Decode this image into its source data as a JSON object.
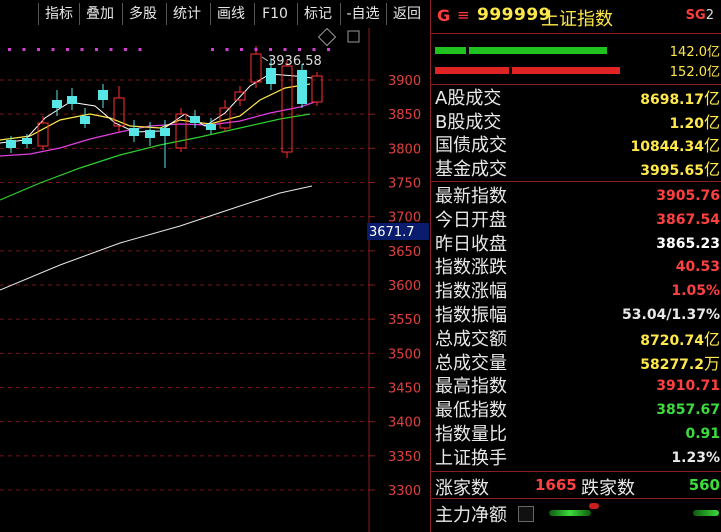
{
  "toolbar": {
    "buttons": [
      "指标",
      "叠加",
      "多股",
      "统计",
      "画线",
      "F10",
      "标记",
      "-自选",
      "返回"
    ]
  },
  "chart": {
    "price_labels": [
      "3900",
      "3850",
      "3800",
      "3750",
      "3700",
      "3650",
      "3600",
      "3550",
      "3500",
      "3450",
      "3400",
      "3350",
      "3300"
    ],
    "high_label": "3936.58",
    "crosshair_label": "3671.7"
  },
  "header": {
    "g_label": "G",
    "menu_icon": "menu-icon",
    "code": "999999",
    "name": "上证指数",
    "sg": "SG",
    "sg_num": "2",
    "buy_value": "142.0亿",
    "sell_value": "152.0亿"
  },
  "turnover": [
    {
      "label": "A股成交",
      "value": "8698.17",
      "unit": "亿"
    },
    {
      "label": "B股成交",
      "value": "1.20",
      "unit": "亿"
    },
    {
      "label": "国债成交",
      "value": "10844.34",
      "unit": "亿"
    },
    {
      "label": "基金成交",
      "value": "3995.65",
      "unit": "亿"
    }
  ],
  "stats": [
    {
      "label": "最新指数",
      "value": "3905.76",
      "color": "#ff4040"
    },
    {
      "label": "今日开盘",
      "value": "3867.54",
      "color": "#ff4040"
    },
    {
      "label": "昨日收盘",
      "value": "3865.23",
      "color": "#ffffff"
    },
    {
      "label": "指数涨跌",
      "value": "40.53",
      "color": "#ff4040"
    },
    {
      "label": "指数涨幅",
      "value": "1.05%",
      "color": "#ff4040"
    },
    {
      "label": "指数振幅",
      "value": "53.04/1.37%",
      "color": "#e8e8e8"
    },
    {
      "label": "总成交额",
      "value": "8720.74",
      "unit": "亿",
      "color": "#ffe84a"
    },
    {
      "label": "总成交量",
      "value": "58277.2",
      "unit": "万",
      "color": "#ffe84a"
    },
    {
      "label": "最高指数",
      "value": "3910.71",
      "color": "#ff4040"
    },
    {
      "label": "最低指数",
      "value": "3857.67",
      "color": "#3ddc3d"
    },
    {
      "label": "指数量比",
      "value": "0.91",
      "color": "#3ddc3d"
    },
    {
      "label": "上证换手",
      "value": "1.23%",
      "color": "#e8e8e8"
    }
  ],
  "breadth": {
    "up_label": "涨家数",
    "up_value": "1665",
    "down_label": "跌家数",
    "down_value": "560"
  },
  "net_flow": {
    "label": "主力净额"
  }
}
